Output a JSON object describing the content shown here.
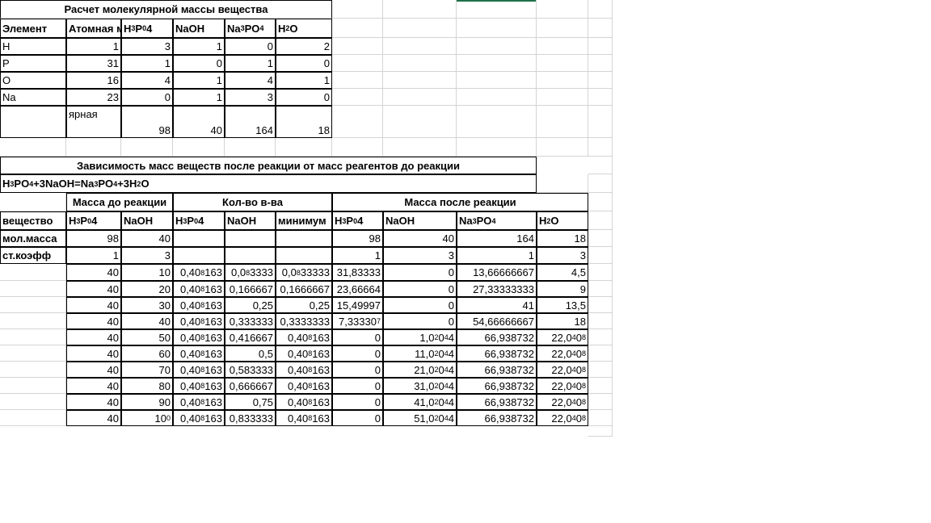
{
  "table1": {
    "title": "Расчет молекулярной массы вещества",
    "headers": [
      "Элемент",
      "Атомная масса",
      "H3P04",
      "NaOH",
      "Na3PO4",
      "H2O"
    ],
    "rows": [
      [
        "H",
        "1",
        "3",
        "1",
        "0",
        "2"
      ],
      [
        "P",
        "31",
        "1",
        "0",
        "1",
        "0"
      ],
      [
        "O",
        "16",
        "4",
        "1",
        "4",
        "1"
      ],
      [
        "Na",
        "23",
        "0",
        "1",
        "3",
        "0"
      ]
    ],
    "molar_row": [
      "",
      "ярная",
      "98",
      "40",
      "164",
      "18"
    ]
  },
  "table2": {
    "title": "Зависимость масс веществ после реакции от масс  реагентов до реакции",
    "equation": "H3PO4+3NaOH=Na3PO4+3H2O",
    "group_headers": [
      "Масса до реакции",
      "Кол-во в-ва",
      "Масса после реакции"
    ],
    "headers": [
      "вещество",
      "H3P04",
      "NaOH",
      "H3P04",
      "NaOH",
      "минимум",
      "H3P04",
      "NaOH",
      "Na3PO4",
      "H2O"
    ],
    "molmass_row": [
      "мол.масса",
      "98",
      "40",
      "",
      "",
      "",
      "98",
      "40",
      "164",
      "18"
    ],
    "coeff_row": [
      "ст.коэфф",
      "1",
      "3",
      "",
      "",
      "",
      "1",
      "3",
      "1",
      "3"
    ],
    "rows": [
      [
        "",
        "40",
        "10",
        "0,408163",
        "0,083333",
        "0,0833333",
        "31,83333",
        "0",
        "13,66666667",
        "4,5"
      ],
      [
        "",
        "40",
        "20",
        "0,408163",
        "0,166667",
        "0,1666667",
        "23,66664",
        "0",
        "27,33333333",
        "9"
      ],
      [
        "",
        "40",
        "30",
        "0,408163",
        "0,25",
        "0,25",
        "15,49997",
        "0",
        "41",
        "13,5"
      ],
      [
        "",
        "40",
        "40",
        "0,408163",
        "0,333333",
        "0,3333333",
        "7,333307",
        "0",
        "54,66666667",
        "18"
      ],
      [
        "",
        "40",
        "50",
        "0,408163",
        "0,416667",
        "0,408163",
        "0",
        "1,02044",
        "66,938732",
        "22,0408"
      ],
      [
        "",
        "40",
        "60",
        "0,408163",
        "0,5",
        "0,408163",
        "0",
        "11,02044",
        "66,938732",
        "22,0408"
      ],
      [
        "",
        "40",
        "70",
        "0,408163",
        "0,583333",
        "0,408163",
        "0",
        "21,02044",
        "66,938732",
        "22,0408"
      ],
      [
        "",
        "40",
        "80",
        "0,408163",
        "0,666667",
        "0,408163",
        "0",
        "31,02044",
        "66,938732",
        "22,0408"
      ],
      [
        "",
        "40",
        "90",
        "0,408163",
        "0,75",
        "0,408163",
        "0",
        "41,02044",
        "66,938732",
        "22,0408"
      ],
      [
        "",
        "40",
        "100",
        "0,408163",
        "0,833333",
        "0,408163",
        "0",
        "51,02044",
        "66,938732",
        "22,0408"
      ]
    ]
  },
  "colors": {
    "gridline": "#d4d4d4",
    "border": "#000000",
    "selection": "#1e7145"
  }
}
